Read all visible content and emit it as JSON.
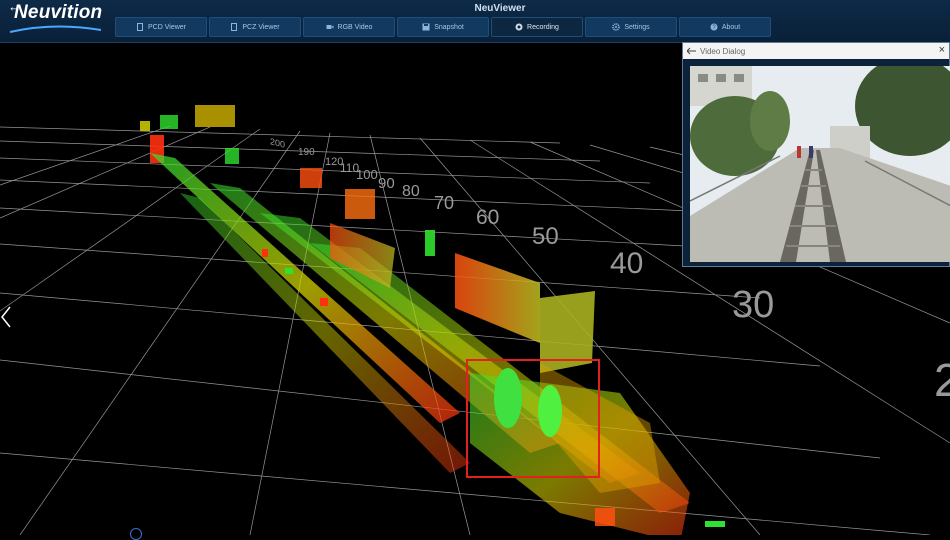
{
  "app": {
    "logo_text": "Neuvition",
    "title": "NeuViewer"
  },
  "tabs": [
    {
      "label": "PCD Viewer",
      "icon": "file-icon"
    },
    {
      "label": "PCZ Viewer",
      "icon": "file-icon"
    },
    {
      "label": "RGB Video",
      "icon": "video-icon"
    },
    {
      "label": "Snapshot",
      "icon": "save-icon"
    },
    {
      "label": "Recording",
      "icon": "record-icon"
    },
    {
      "label": "Settings",
      "icon": "gear-icon"
    },
    {
      "label": "About",
      "icon": "help-icon"
    }
  ],
  "active_tab": "Recording",
  "viewport": {
    "distance_labels": [
      "200",
      "190",
      "120",
      "110",
      "100",
      "90",
      "80",
      "70",
      "60",
      "50",
      "40",
      "30",
      "2"
    ],
    "detection_box_color": "#e32020"
  },
  "video_dialog": {
    "title": "Video Dialog"
  },
  "colors": {
    "topbar": "#0d2a47",
    "grid": "#cfcfcf",
    "point_near": "#ff3a1a",
    "point_mid": "#e6e600",
    "point_far": "#20e020"
  }
}
